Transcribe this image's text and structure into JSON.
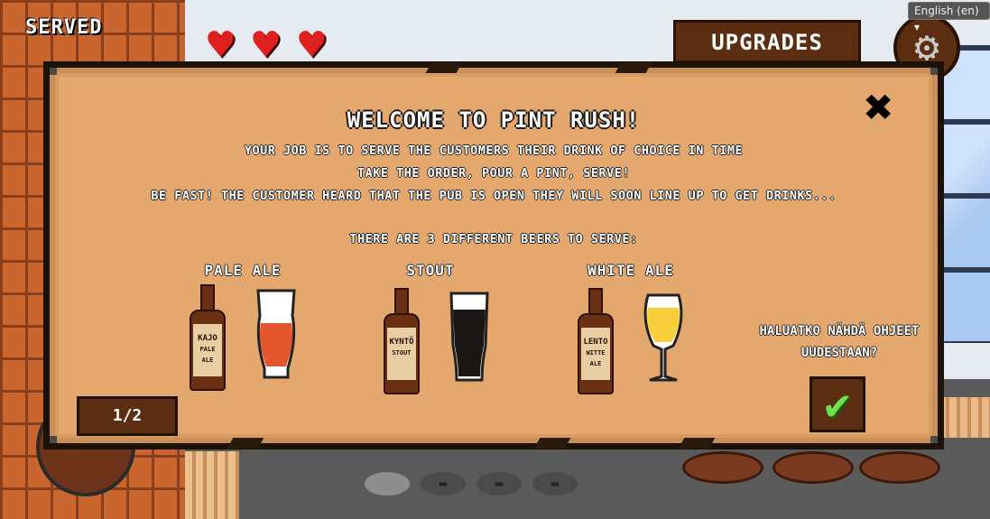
{
  "hud": {
    "served_label": "SERVED",
    "lives": 3,
    "upgrades_label": "UPGRADES",
    "settings_icon": "gear-icon",
    "language": "English (en) ▾"
  },
  "dialog": {
    "title": "WELCOME TO PINT RUSH!",
    "lines": [
      "YOUR JOB IS TO SERVE THE CUSTOMERS THEIR DRINK OF CHOICE IN TIME",
      "TAKE THE ORDER, POUR A PINT, SERVE!",
      "BE FAST! THE CUSTOMER HEARD THAT THE PUB IS OPEN THEY WILL SOON LINE UP TO GET DRINKS..."
    ],
    "beers_intro": "THERE ARE 3 DIFFERENT BEERS TO SERVE:",
    "beers": [
      {
        "name": "PALE ALE",
        "bottle_label": "KAJO",
        "bottle_sub": "PALE ALE",
        "beer_color": "#e4572e"
      },
      {
        "name": "STOUT",
        "bottle_label": "KYNTÖ",
        "bottle_sub": "STOUT",
        "beer_color": "#1a1616"
      },
      {
        "name": "WHITE ALE",
        "bottle_label": "LENTO",
        "bottle_sub": "WITTE ALE",
        "beer_color": "#f7cf3a"
      }
    ],
    "question": "HALUATKO NÄHDÄ OHJEET UUDESTAAN?",
    "confirm_icon": "checkmark-icon",
    "close_icon": "close-icon",
    "page": "1/2"
  },
  "colors": {
    "parchment": "#e4a86e",
    "wood": "#5b2e12",
    "check": "#6ee04a"
  }
}
